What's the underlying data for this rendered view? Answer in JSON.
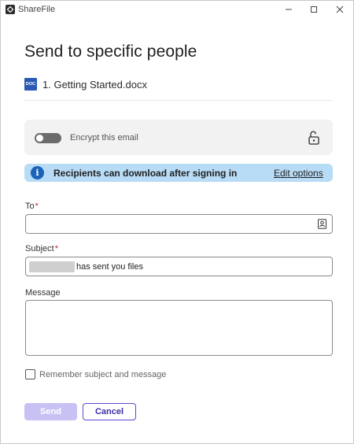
{
  "window": {
    "app_title": "ShareFile",
    "app_icon": "sharefile-logo-icon",
    "controls": [
      "minimize-icon",
      "maximize-icon",
      "close-icon"
    ]
  },
  "dialog": {
    "heading": "Send to specific people",
    "file": {
      "type_badge": "DOC",
      "name": "1. Getting Started.docx"
    }
  },
  "encrypt": {
    "label": "Encrypt this email",
    "enabled": false,
    "icon": "unlocked-padlock-icon"
  },
  "banner": {
    "icon": "info-icon",
    "icon_glyph": "i",
    "text": "Recipients can download after signing in",
    "link_label": "Edit options"
  },
  "form": {
    "to": {
      "label": "To",
      "required_mark": "*",
      "value": "",
      "icon": "address-book-icon"
    },
    "subject": {
      "label": "Subject",
      "required_mark": "*",
      "value_suffix": "has sent you files"
    },
    "message": {
      "label": "Message",
      "value": ""
    },
    "remember": {
      "label": "Remember subject and message",
      "checked": false
    }
  },
  "actions": {
    "send_label": "Send",
    "cancel_label": "Cancel"
  },
  "colors": {
    "primary": "#5a49d6",
    "primary_disabled": "#c8c2f4",
    "banner_bg": "#b8dcf6",
    "info_icon": "#1a63b8",
    "doc_icon": "#2a5ab3",
    "required": "#c4262e"
  }
}
